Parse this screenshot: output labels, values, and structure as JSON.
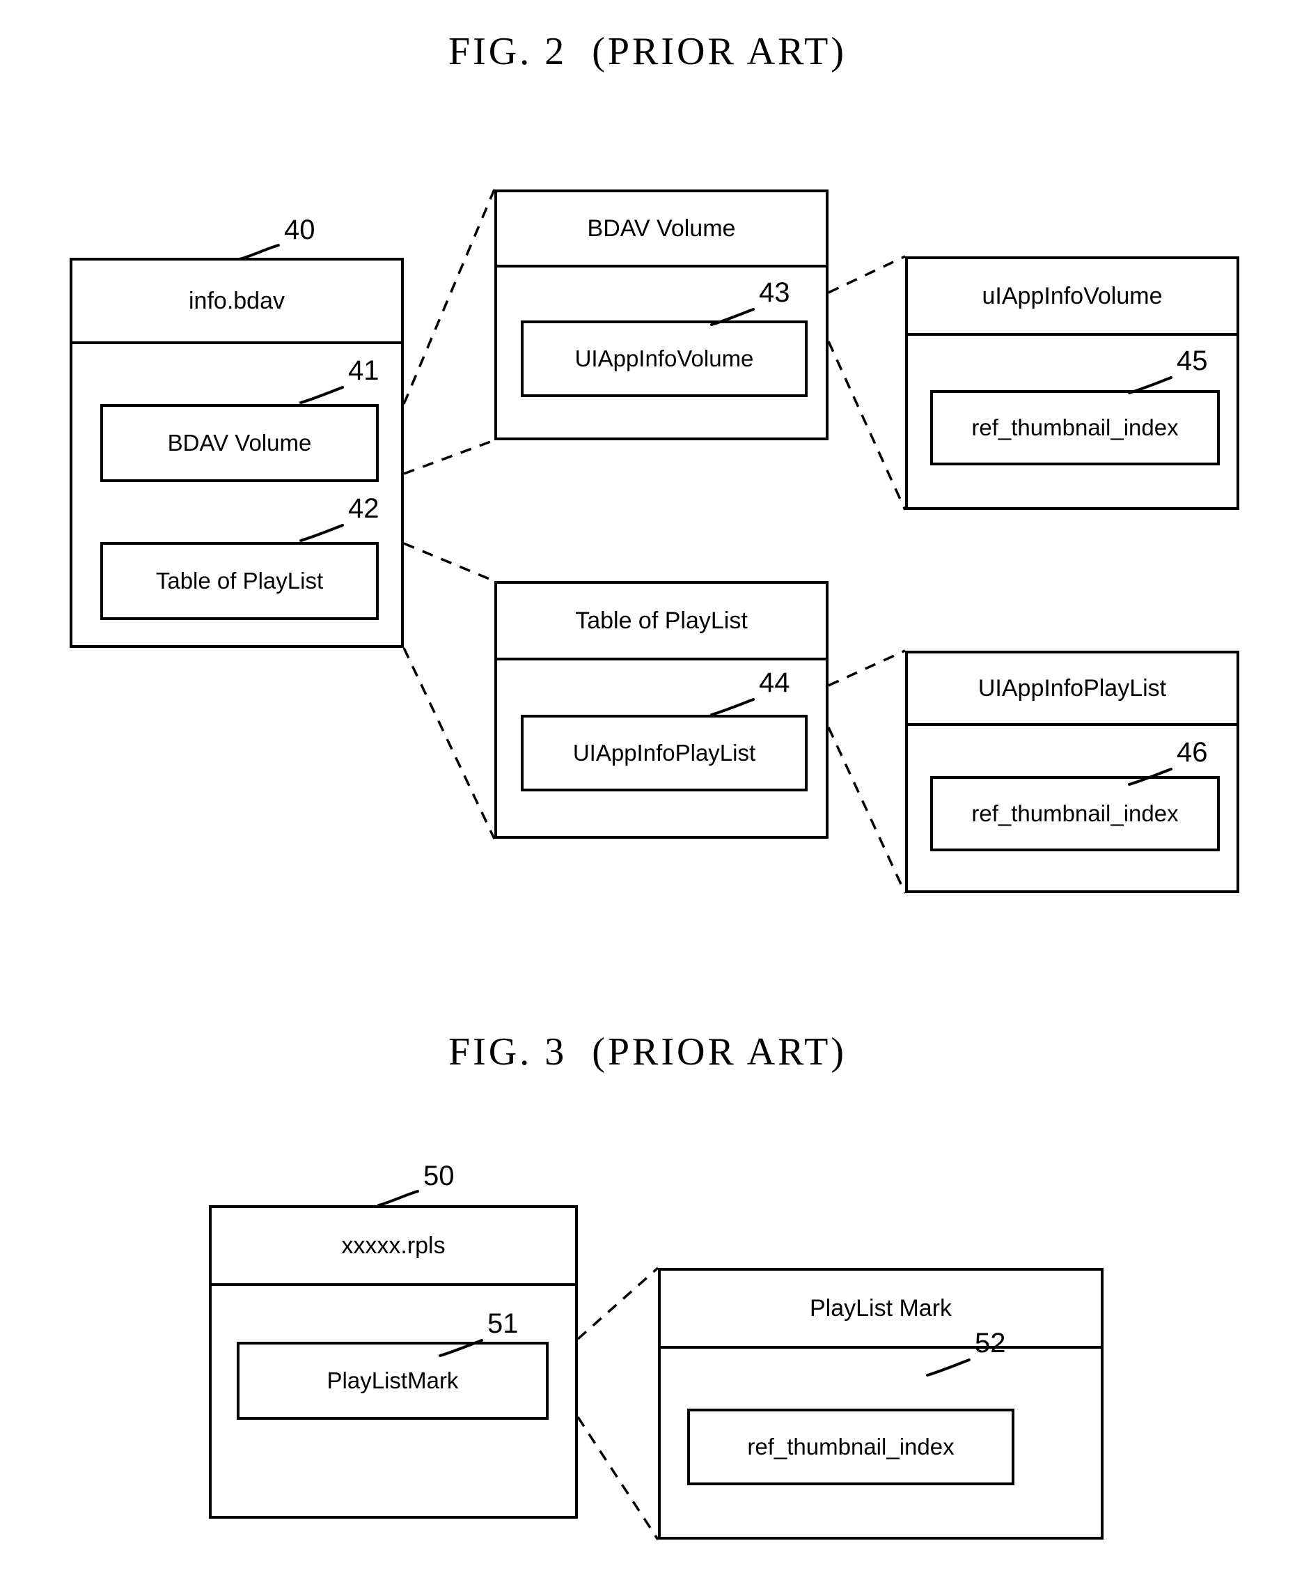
{
  "figures": [
    {
      "caption": "FIG. 2  (PRIOR ART)",
      "nodes": {
        "info_bdav": {
          "title": "info.bdav",
          "ref": "40",
          "children": [
            {
              "label": "BDAV Volume",
              "ref": "41"
            },
            {
              "label": "Table of PlayList",
              "ref": "42"
            }
          ]
        },
        "bdav_volume": {
          "title": "BDAV Volume",
          "children": [
            {
              "label": "UIAppInfoVolume",
              "ref": "43"
            }
          ]
        },
        "uiappinfovolume": {
          "title": "uIAppInfoVolume",
          "children": [
            {
              "label": "ref_thumbnail_index",
              "ref": "45"
            }
          ]
        },
        "table_of_playlist": {
          "title": "Table of PlayList",
          "children": [
            {
              "label": "UIAppInfoPlayList",
              "ref": "44"
            }
          ]
        },
        "uiappinfoplaylist": {
          "title": "UIAppInfoPlayList",
          "children": [
            {
              "label": "ref_thumbnail_index",
              "ref": "46"
            }
          ]
        }
      }
    },
    {
      "caption": "FIG. 3  (PRIOR ART)",
      "nodes": {
        "rpls": {
          "title": "xxxxx.rpls",
          "ref": "50",
          "children": [
            {
              "label": "PlayListMark",
              "ref": "51"
            }
          ]
        },
        "playlist_mark": {
          "title": "PlayList Mark",
          "children": [
            {
              "label": "ref_thumbnail_index",
              "ref": "52"
            }
          ]
        }
      }
    }
  ],
  "colors": {
    "stroke": "#000000",
    "background": "#ffffff"
  }
}
